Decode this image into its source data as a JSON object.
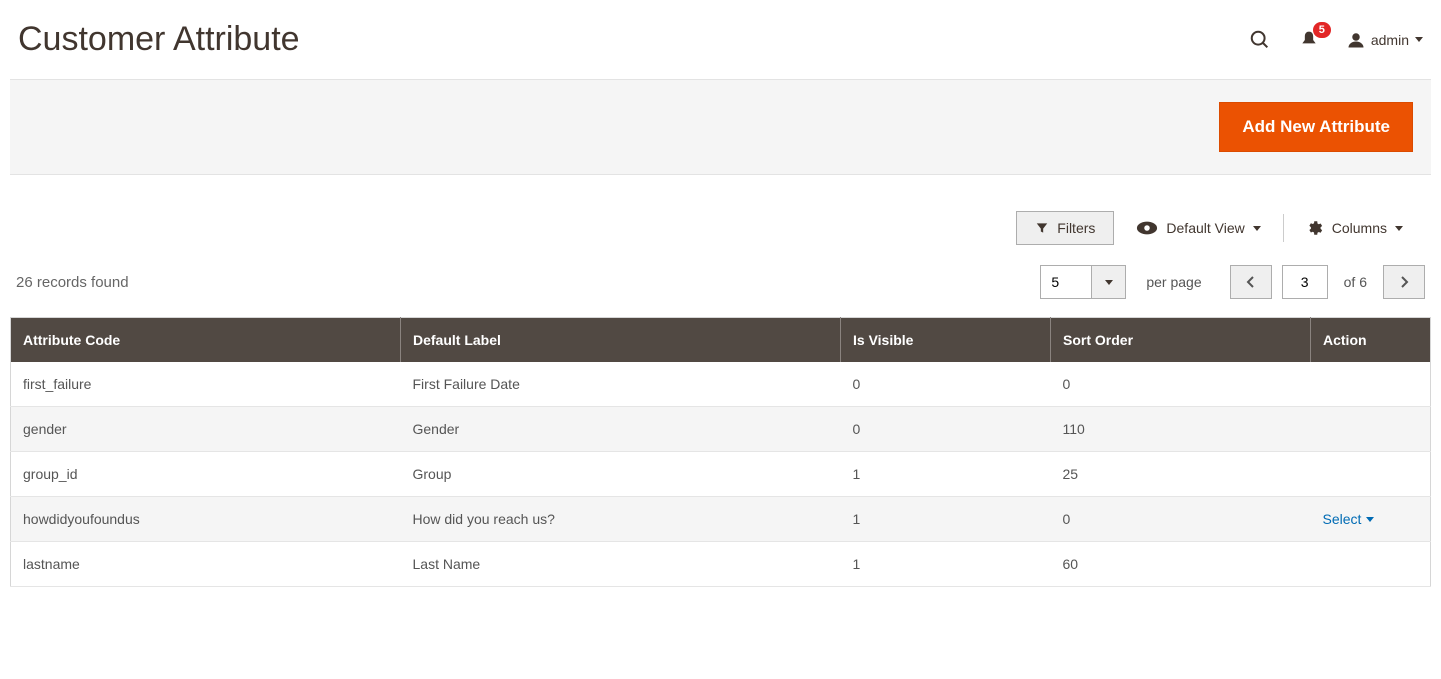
{
  "header": {
    "title": "Customer Attribute",
    "notification_count": "5",
    "username": "admin"
  },
  "actions": {
    "add_new_label": "Add New Attribute"
  },
  "toolbar": {
    "filters_label": "Filters",
    "default_view_label": "Default View",
    "columns_label": "Columns"
  },
  "grid": {
    "records_found": "26 records found",
    "per_page_value": "5",
    "per_page_label": "per page",
    "current_page": "3",
    "total_pages_label": "of 6",
    "columns": {
      "code": "Attribute Code",
      "label": "Default Label",
      "visible": "Is Visible",
      "sort": "Sort Order",
      "action": "Action"
    },
    "action_select_label": "Select",
    "rows": [
      {
        "code": "first_failure",
        "label": "First Failure Date",
        "visible": "0",
        "sort": "0",
        "action": ""
      },
      {
        "code": "gender",
        "label": "Gender",
        "visible": "0",
        "sort": "110",
        "action": ""
      },
      {
        "code": "group_id",
        "label": "Group",
        "visible": "1",
        "sort": "25",
        "action": ""
      },
      {
        "code": "howdidyoufoundus",
        "label": "How did you reach us?",
        "visible": "1",
        "sort": "0",
        "action": "select"
      },
      {
        "code": "lastname",
        "label": "Last Name",
        "visible": "1",
        "sort": "60",
        "action": ""
      }
    ]
  }
}
